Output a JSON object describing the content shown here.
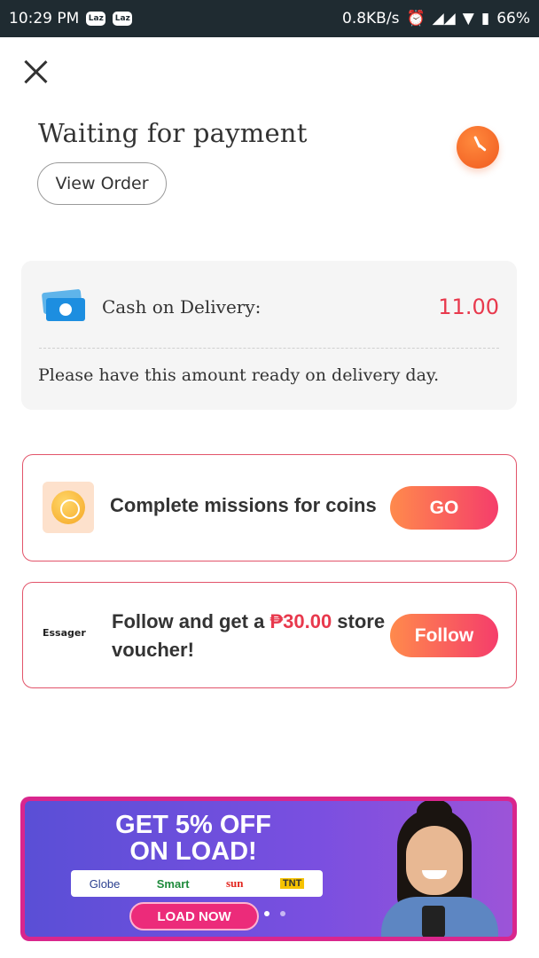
{
  "status_bar": {
    "time": "10:29 PM",
    "app_badges": [
      "Laz",
      "Laz"
    ],
    "network_speed": "0.8KB/s",
    "battery": "66%"
  },
  "header": {
    "title": "Waiting for payment",
    "view_order_label": "View Order"
  },
  "payment": {
    "method_label": "Cash on Delivery:",
    "amount": "11.00",
    "note": "Please have this amount ready on delivery day."
  },
  "mission_card": {
    "text": "Complete missions for coins",
    "button_label": "GO"
  },
  "follow_card": {
    "store_name": "Essager",
    "text_prefix": "Follow and get a ",
    "voucher_amount": "₱30.00",
    "text_suffix": " store voucher!",
    "button_label": "Follow"
  },
  "banner": {
    "headline_line1": "GET 5% OFF",
    "headline_line2": "ON LOAD!",
    "telcos": [
      "Globe",
      "Smart",
      "sun",
      "TNT"
    ],
    "cta": "LOAD NOW"
  },
  "colors": {
    "accent": "#e8394d",
    "button_gradient_start": "#ff8a4c",
    "button_gradient_end": "#f53d6b",
    "status_bar": "#1f2b31"
  }
}
